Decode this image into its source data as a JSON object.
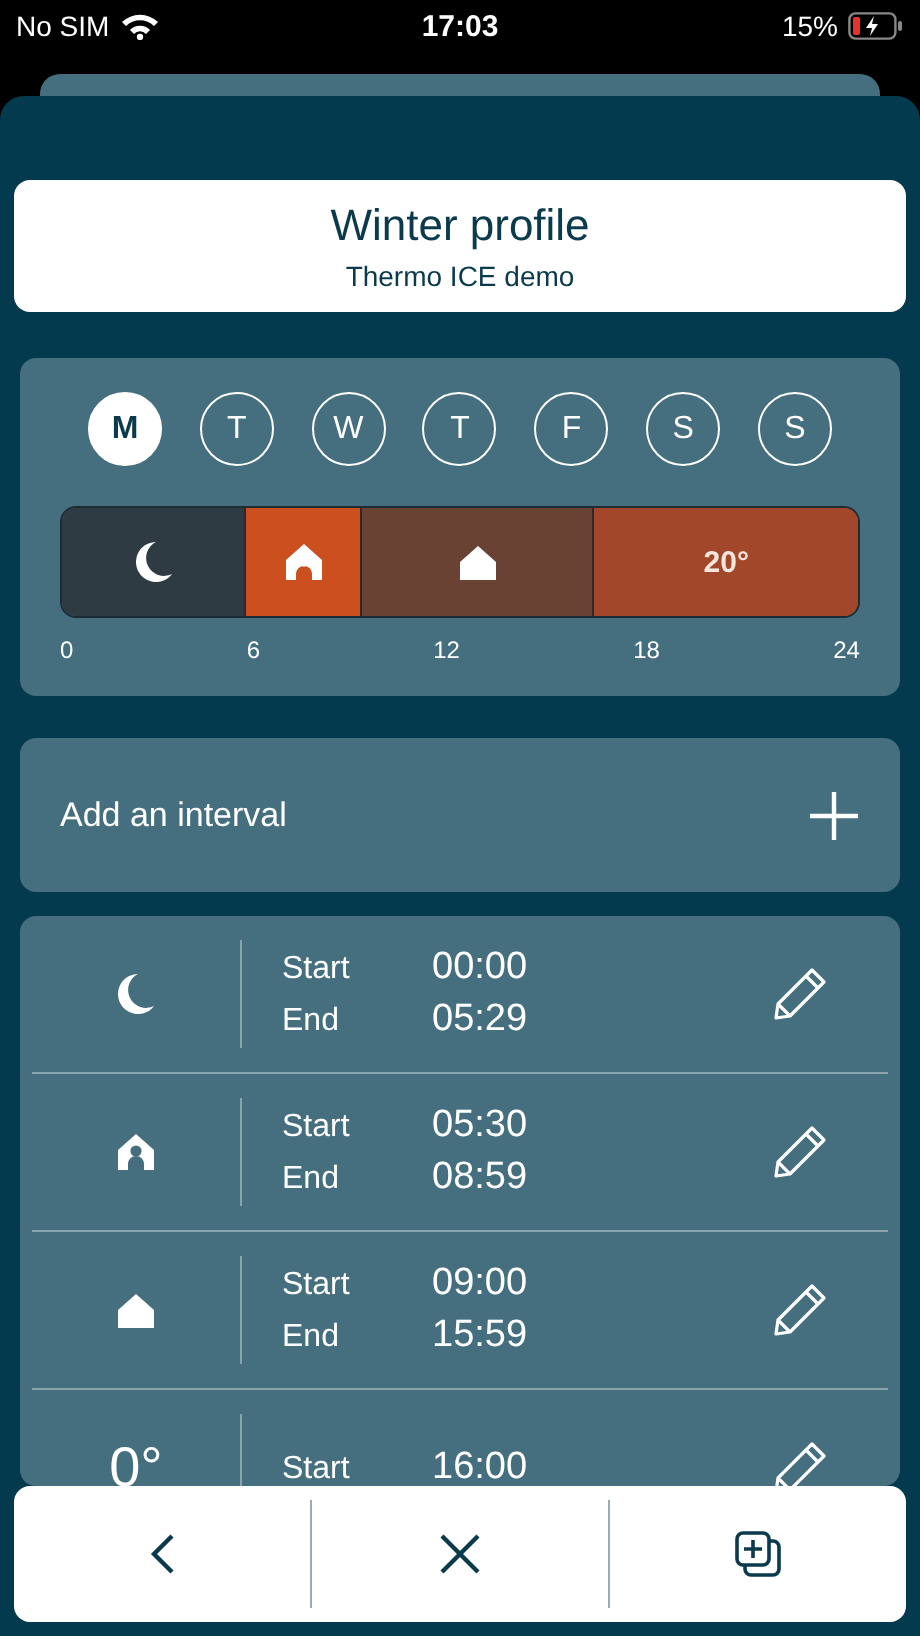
{
  "status_bar": {
    "carrier": "No SIM",
    "time": "17:03",
    "battery": "15%"
  },
  "header": {
    "title": "Winter profile",
    "subtitle": "Thermo ICE demo"
  },
  "days": [
    {
      "label": "M",
      "selected": true
    },
    {
      "label": "T",
      "selected": false
    },
    {
      "label": "W",
      "selected": false
    },
    {
      "label": "T",
      "selected": false
    },
    {
      "label": "F",
      "selected": false
    },
    {
      "label": "S",
      "selected": false
    },
    {
      "label": "S",
      "selected": false
    }
  ],
  "timeline": {
    "segments": [
      {
        "kind": "night",
        "color": "#2f3b42"
      },
      {
        "kind": "away",
        "color": "#cc4f1f"
      },
      {
        "kind": "home",
        "color": "#6a4234"
      },
      {
        "kind": "temp",
        "color": "#a3472a",
        "label": "20°"
      }
    ],
    "ticks": [
      "0",
      "6",
      "12",
      "18",
      "24"
    ]
  },
  "add_interval": {
    "label": "Add an interval"
  },
  "intervals": [
    {
      "kind": "night",
      "start_label": "Start",
      "start": "00:00",
      "end_label": "End",
      "end": "05:29"
    },
    {
      "kind": "away",
      "start_label": "Start",
      "start": "05:30",
      "end_label": "End",
      "end": "08:59"
    },
    {
      "kind": "home",
      "start_label": "Start",
      "start": "09:00",
      "end_label": "End",
      "end": "15:59"
    },
    {
      "kind": "temp",
      "label": "0°",
      "start_label": "Start",
      "start": "16:00"
    }
  ]
}
